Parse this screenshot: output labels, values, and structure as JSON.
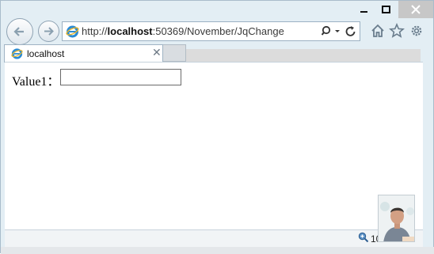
{
  "window": {
    "controls": {
      "minimize": "minimize-icon",
      "maximize": "maximize-icon",
      "close": "close-icon"
    }
  },
  "addressbar": {
    "url_prefix": "http://",
    "url_host": "localhost",
    "url_rest": ":50369/November/JqChange"
  },
  "tabs": [
    {
      "label": "localhost",
      "active": true
    }
  ],
  "form": {
    "value1_label": "Value1：",
    "value1_value": ""
  },
  "statusbar": {
    "zoom": "100%"
  },
  "colors": {
    "frame": "#e3eef4",
    "accent_ie": "#2a8bd4"
  }
}
